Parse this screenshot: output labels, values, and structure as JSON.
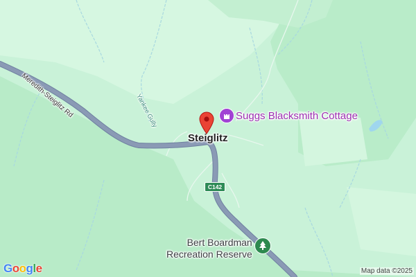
{
  "map": {
    "town_label": "Steiglitz",
    "road_label": "Meredith-Steiglitz Rd",
    "creek_label": "Yankee Gully",
    "poi": {
      "name": "Suggs Blacksmith Cottage",
      "icon": "castle-icon"
    },
    "route_shield": "C142",
    "reserve": {
      "line1": "Bert Boardman",
      "line2": "Recreation Reserve",
      "icon": "tree-icon"
    },
    "pin_icon": "map-pin-icon"
  },
  "footer": {
    "logo": "Google",
    "attribution": "Map data ©2025"
  },
  "colors": {
    "land": "#c9f2d8",
    "forest_dark": "#b8ebc8",
    "forest_light": "#d6f7e1",
    "road": "#8a9ab5",
    "road_outline": "#6f80a0",
    "water": "#9fd6ee",
    "stream": "#a8d8e0",
    "pin": "#ea4335",
    "poi": "#a142d4",
    "park": "#2d8a4f"
  }
}
